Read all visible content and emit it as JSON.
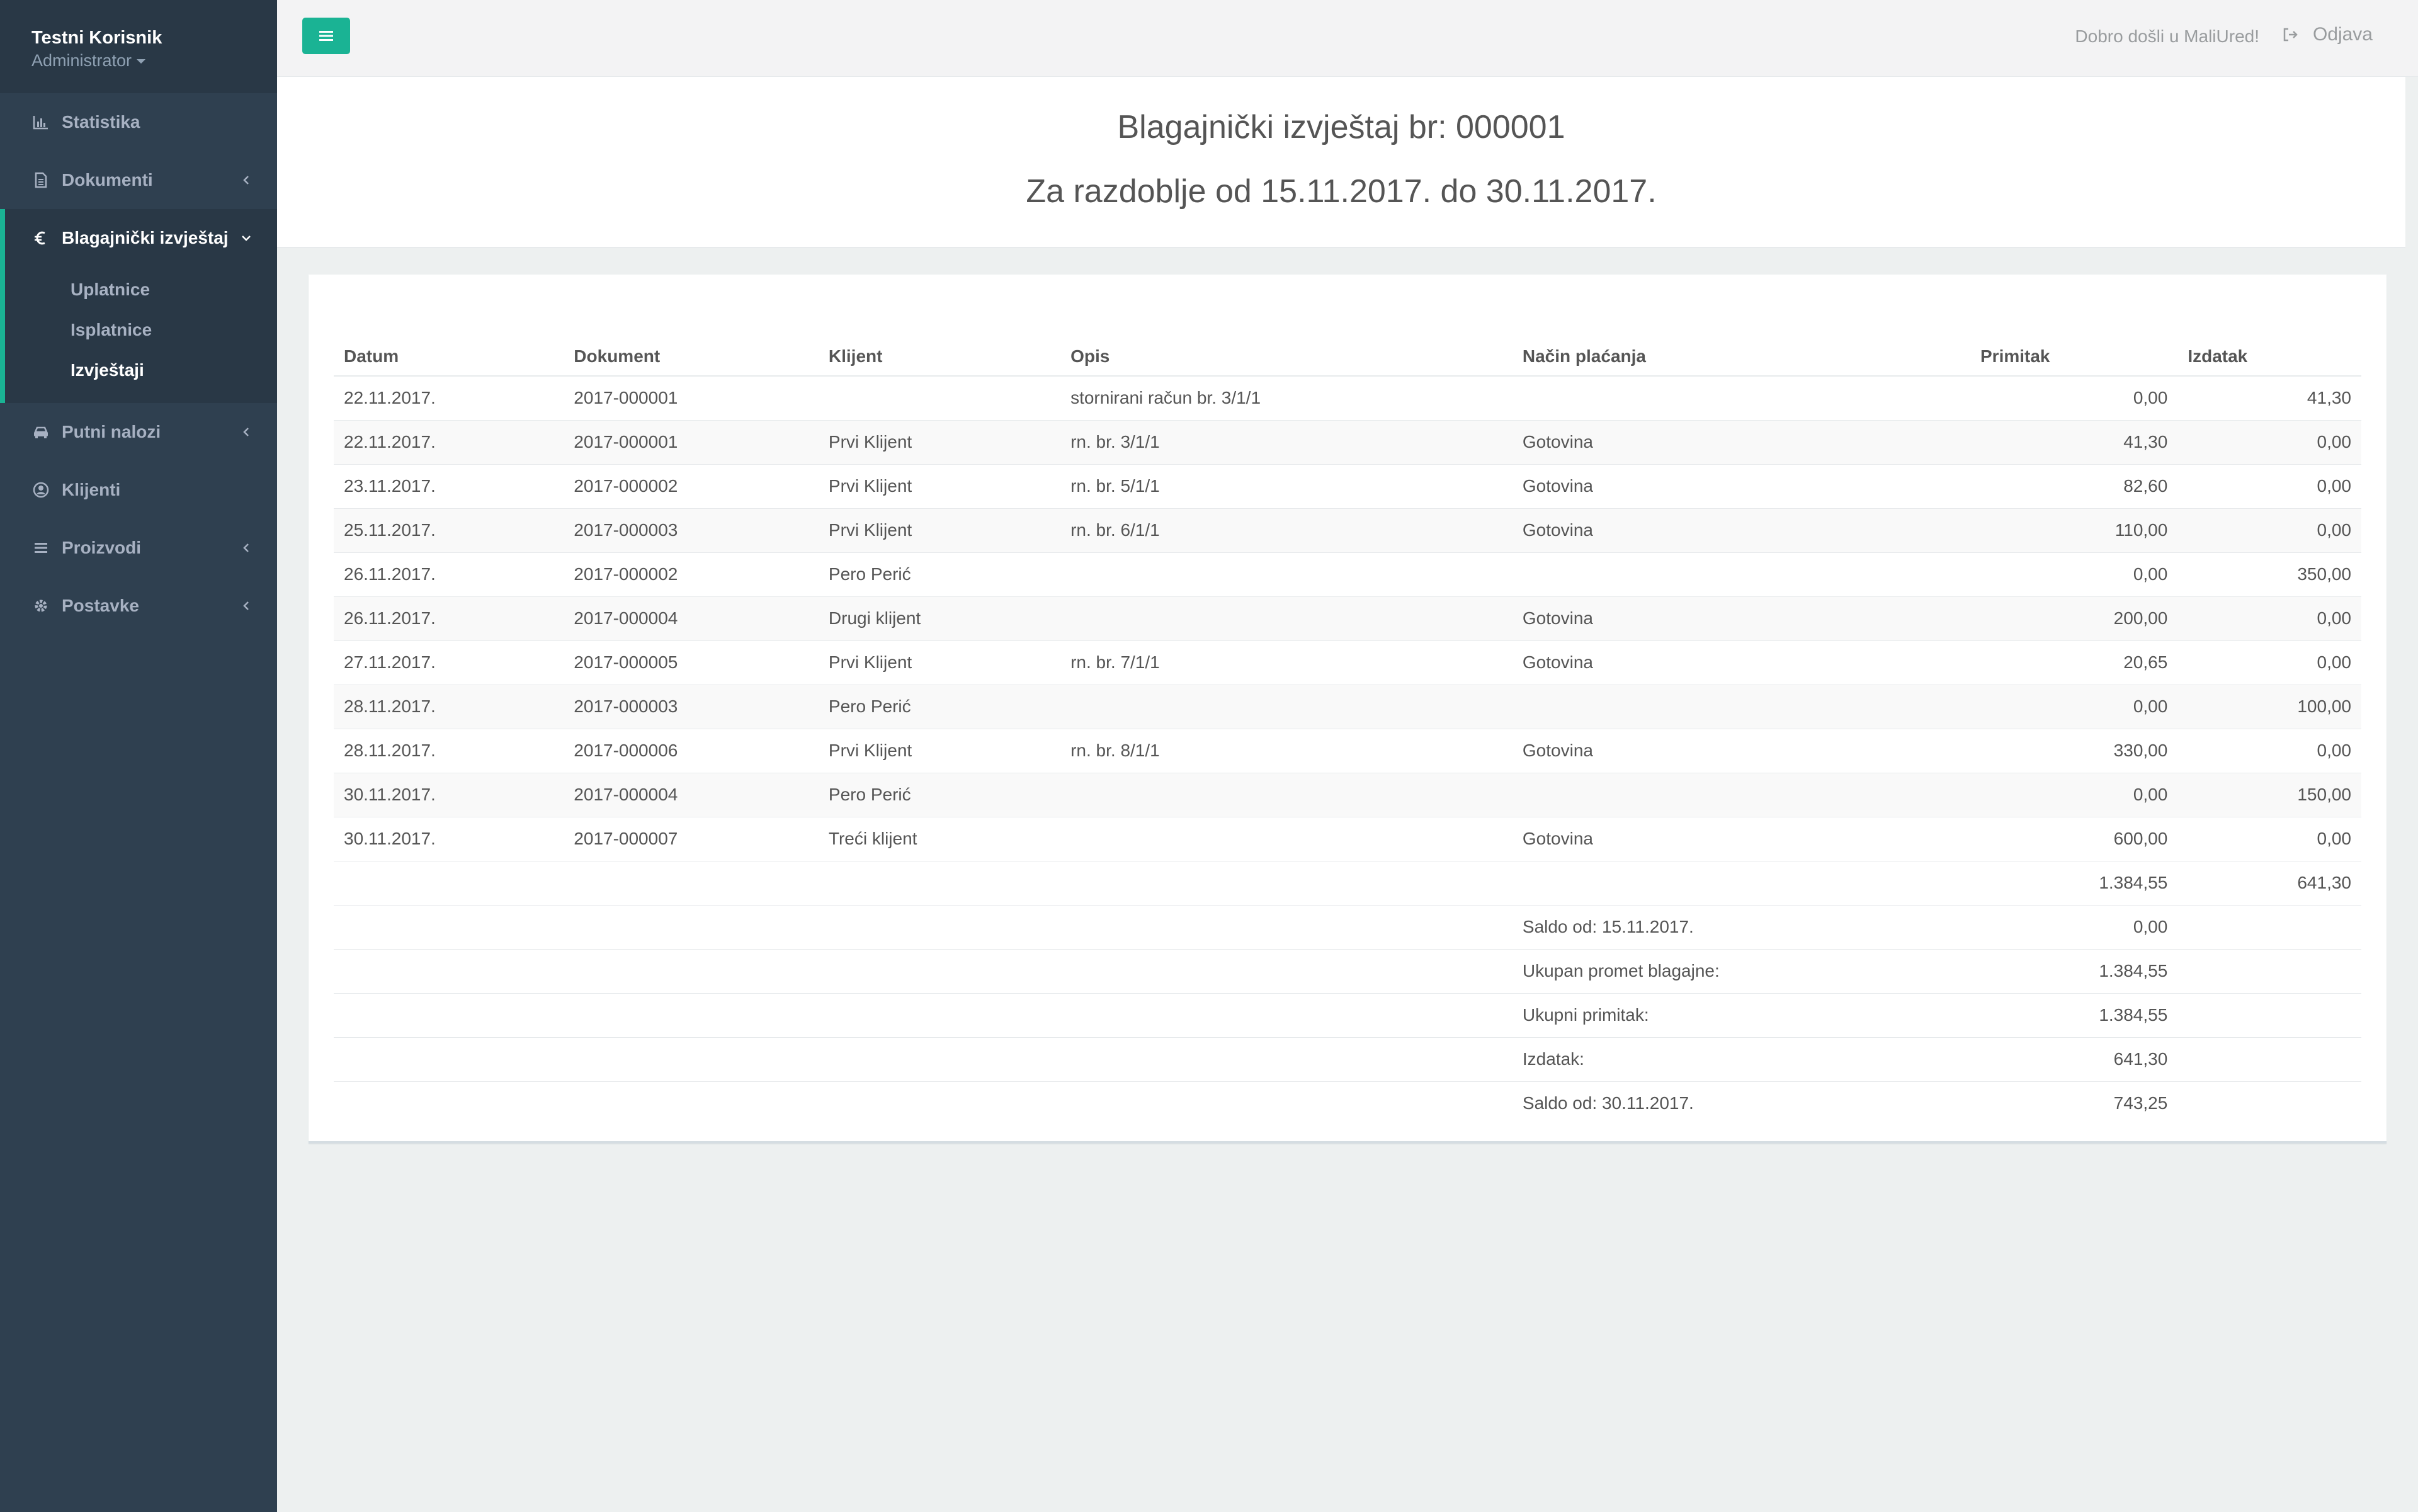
{
  "sidebar": {
    "user_name": "Testni Korisnik",
    "user_role": "Administrator",
    "items": [
      {
        "label": "Statistika",
        "icon": "bar-chart-icon"
      },
      {
        "label": "Dokumenti",
        "icon": "document-icon"
      },
      {
        "label": "Blagajnički izvještaj",
        "icon": "euro-icon",
        "active": true
      },
      {
        "label": "Putni nalozi",
        "icon": "car-icon"
      },
      {
        "label": "Klijenti",
        "icon": "user-circle-icon"
      },
      {
        "label": "Proizvodi",
        "icon": "list-icon"
      },
      {
        "label": "Postavke",
        "icon": "gear-icon"
      }
    ],
    "submenu": [
      {
        "label": "Uplatnice"
      },
      {
        "label": "Isplatnice"
      },
      {
        "label": "Izvještaji",
        "current": true
      }
    ]
  },
  "topbar": {
    "welcome": "Dobro došli u MaliUred!",
    "logout": "Odjava"
  },
  "heading": {
    "title": "Blagajnički izvještaj br: 000001",
    "period": "Za razdoblje od 15.11.2017. do 30.11.2017."
  },
  "table": {
    "headers": [
      "Datum",
      "Dokument",
      "Klijent",
      "Opis",
      "Način plaćanja",
      "Primitak",
      "Izdatak"
    ],
    "rows": [
      [
        "22.11.2017.",
        "2017-000001",
        "",
        "stornirani račun br. 3/1/1",
        "",
        "0,00",
        "41,30"
      ],
      [
        "22.11.2017.",
        "2017-000001",
        "Prvi Klijent",
        "rn. br. 3/1/1",
        "Gotovina",
        "41,30",
        "0,00"
      ],
      [
        "23.11.2017.",
        "2017-000002",
        "Prvi Klijent",
        "rn. br. 5/1/1",
        "Gotovina",
        "82,60",
        "0,00"
      ],
      [
        "25.11.2017.",
        "2017-000003",
        "Prvi Klijent",
        "rn. br. 6/1/1",
        "Gotovina",
        "110,00",
        "0,00"
      ],
      [
        "26.11.2017.",
        "2017-000002",
        "Pero Perić",
        "",
        "",
        "0,00",
        "350,00"
      ],
      [
        "26.11.2017.",
        "2017-000004",
        "Drugi klijent",
        "",
        "Gotovina",
        "200,00",
        "0,00"
      ],
      [
        "27.11.2017.",
        "2017-000005",
        "Prvi Klijent",
        "rn. br. 7/1/1",
        "Gotovina",
        "20,65",
        "0,00"
      ],
      [
        "28.11.2017.",
        "2017-000003",
        "Pero Perić",
        "",
        "",
        "0,00",
        "100,00"
      ],
      [
        "28.11.2017.",
        "2017-000006",
        "Prvi Klijent",
        "rn. br. 8/1/1",
        "Gotovina",
        "330,00",
        "0,00"
      ],
      [
        "30.11.2017.",
        "2017-000004",
        "Pero Perić",
        "",
        "",
        "0,00",
        "150,00"
      ],
      [
        "30.11.2017.",
        "2017-000007",
        "Treći klijent",
        "",
        "Gotovina",
        "600,00",
        "0,00"
      ]
    ],
    "totals": {
      "primitak": "1.384,55",
      "izdatak": "641,30"
    },
    "summary": [
      {
        "label": "Saldo od: 15.11.2017.",
        "value": "0,00"
      },
      {
        "label": "Ukupan promet blagajne:",
        "value": "1.384,55"
      },
      {
        "label": "Ukupni primitak:",
        "value": "1.384,55"
      },
      {
        "label": "Izdatak:",
        "value": "641,30"
      },
      {
        "label": "Saldo od: 30.11.2017.",
        "value": "743,25"
      }
    ]
  },
  "colors": {
    "accent": "#1ab394",
    "sidebar": "#2f4050",
    "sidebar_dark": "#293846"
  }
}
